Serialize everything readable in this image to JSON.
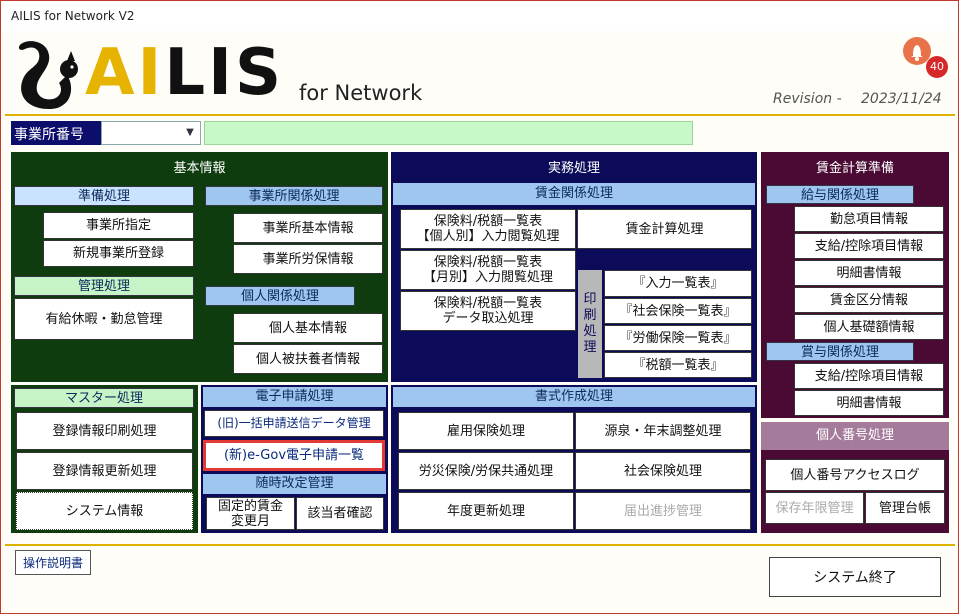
{
  "window": {
    "title": "AILIS for Network V2"
  },
  "logo": {
    "brand_ai": "AI",
    "brand_rest": "LIS",
    "sub": "for Network"
  },
  "header": {
    "revision_label": "Revision -",
    "revision_date": "2023/11/24",
    "notification_count": "40"
  },
  "office": {
    "label": "事業所番号",
    "value": "",
    "display": ""
  },
  "kihon": {
    "title": "基本情報",
    "junbi": {
      "title": "準備処理",
      "items": [
        "事業所指定",
        "新規事業所登録"
      ]
    },
    "kanri": {
      "title": "管理処理",
      "items": [
        "有給休暇・勤怠管理"
      ]
    },
    "jigyosho": {
      "title": "事業所関係処理",
      "items": [
        "事業所基本情報",
        "事業所労保情報"
      ]
    },
    "kojin": {
      "title": "個人関係処理",
      "items": [
        "個人基本情報",
        "個人被扶養者情報"
      ]
    }
  },
  "jimu": {
    "title": "実務処理",
    "chingin": {
      "title": "賃金関係処理",
      "left": [
        "保険料/税額一覧表\n【個人別】入力閲覧処理",
        "保険料/税額一覧表\n【月別】入力閲覧処理",
        "保険料/税額一覧表\nデータ取込処理"
      ],
      "chingin_keisan": "賃金計算処理",
      "print_label": "印\n刷\n処\n理",
      "print_items": [
        "『入力一覧表』",
        "『社会保険一覧表』",
        "『労働保険一覧表』",
        "『税額一覧表』"
      ]
    }
  },
  "junbi_calc": {
    "title": "賃金計算準備",
    "kyuyo": {
      "title": "給与関係処理",
      "items": [
        "勤怠項目情報",
        "支給/控除項目情報",
        "明細書情報",
        "賃金区分情報",
        "個人基礎額情報"
      ]
    },
    "shoyo": {
      "title": "賞与関係処理",
      "items": [
        "支給/控除項目情報",
        "明細書情報"
      ]
    }
  },
  "master": {
    "title": "マスター処理",
    "items": [
      "登録情報印刷処理",
      "登録情報更新処理",
      "システム情報"
    ]
  },
  "denshi": {
    "title": "電子申請処理",
    "items": [
      "(旧)一括申請送信データ管理",
      "(新)e-Gov電子申請一覧"
    ],
    "zuiji_title": "随時改定管理",
    "zuiji_items": [
      "固定的賃金\n変更月",
      "該当者確認"
    ]
  },
  "shoshiki": {
    "title": "書式作成処理",
    "items": [
      "雇用保険処理",
      "源泉・年末調整処理",
      "労災保険/労保共通処理",
      "社会保険処理",
      "年度更新処理",
      "届出進捗管理"
    ]
  },
  "mynumber": {
    "title": "個人番号処理",
    "items": [
      "個人番号アクセスログ",
      "保存年限管理",
      "管理台帳"
    ]
  },
  "footer": {
    "manual": "操作説明書",
    "exit": "システム終了"
  }
}
